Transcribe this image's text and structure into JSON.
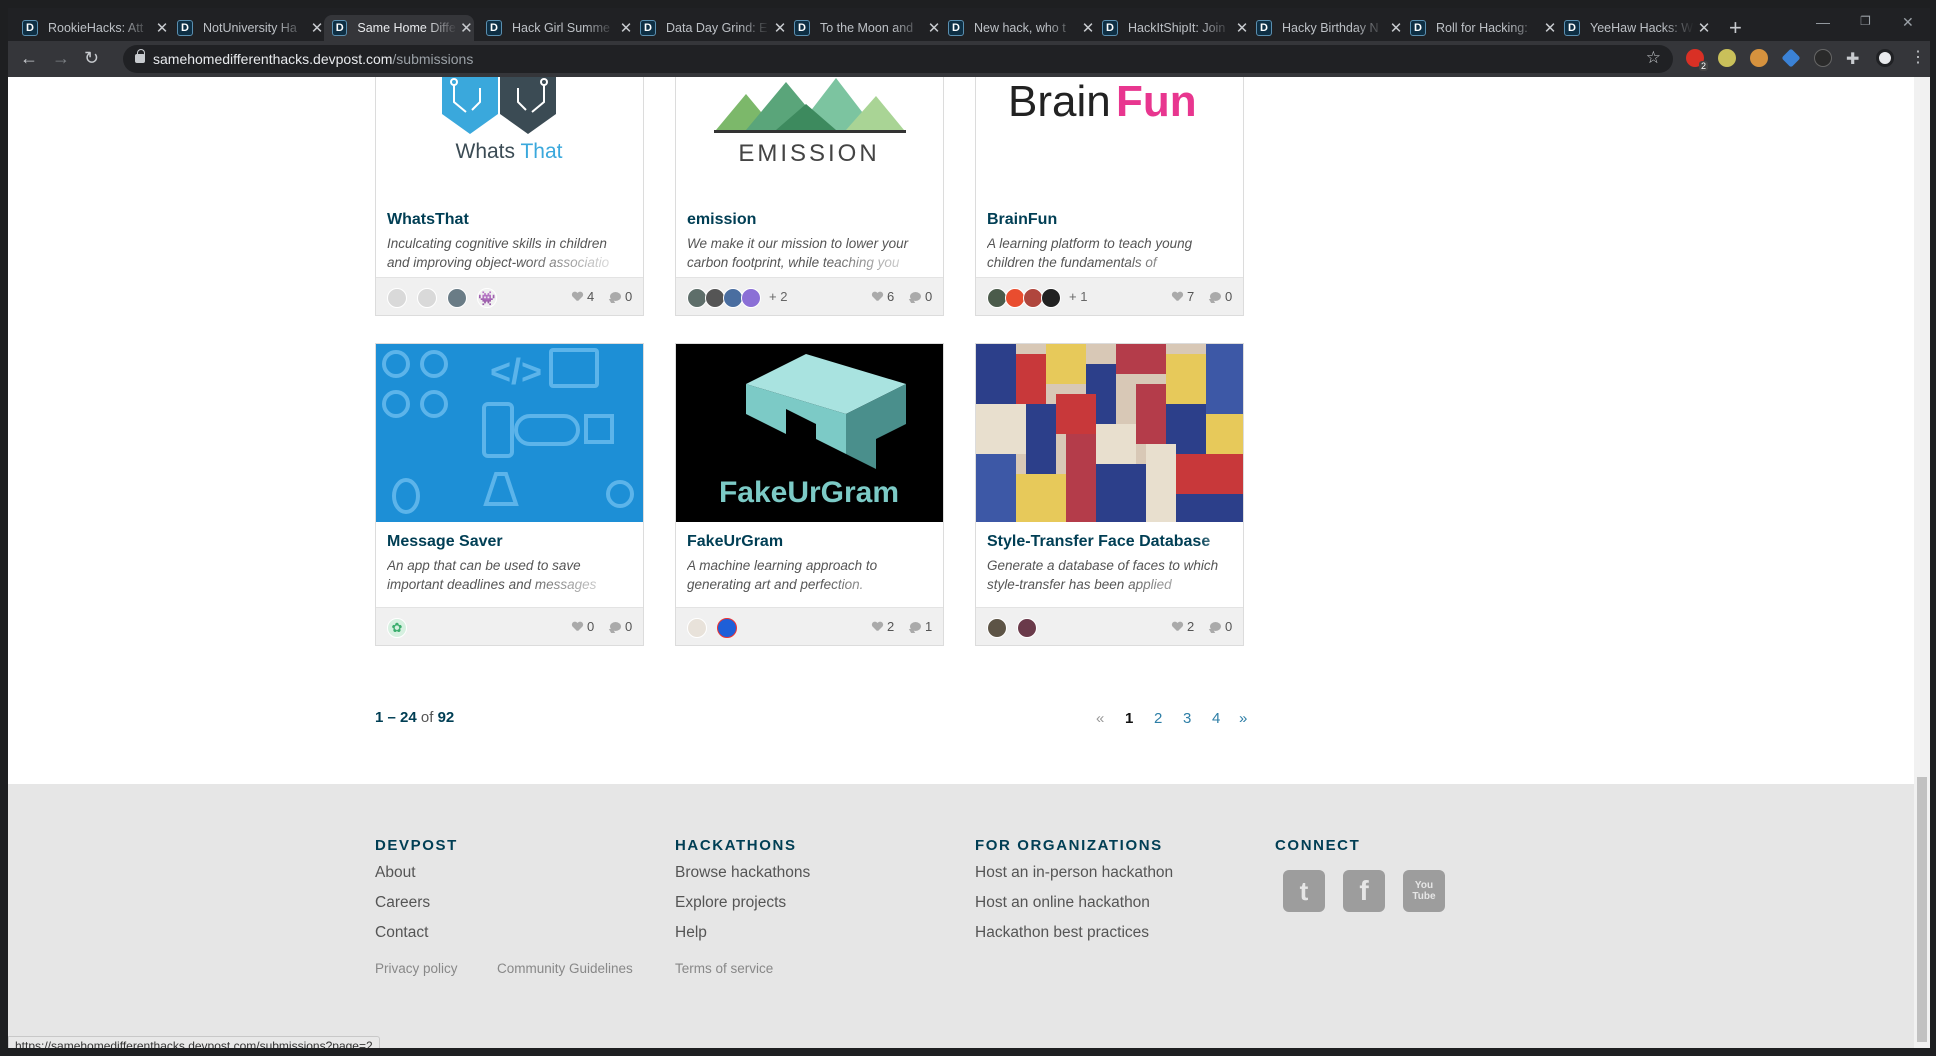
{
  "browser": {
    "tabs": [
      {
        "favicon": "D",
        "title": "RookieHacks: Att"
      },
      {
        "favicon": "D",
        "title": "NotUniversity Ha"
      },
      {
        "favicon": "D",
        "title": "Same Home Diffe"
      },
      {
        "favicon": "D",
        "title": "Hack Girl Summe"
      },
      {
        "favicon": "D",
        "title": "Data Day Grind: E"
      },
      {
        "favicon": "D",
        "title": "To the Moon and"
      },
      {
        "favicon": "D",
        "title": "New hack, who t"
      },
      {
        "favicon": "D",
        "title": "HackItShipIt: Join"
      },
      {
        "favicon": "D",
        "title": "Hacky Birthday N"
      },
      {
        "favicon": "D",
        "title": "Roll for Hacking:"
      },
      {
        "favicon": "D",
        "title": "YeeHaw Hacks: W"
      }
    ],
    "active_tab_index": 2,
    "url_host": "samehomedifferenthacks.devpost.com",
    "url_path": "/submissions",
    "extension_badge": "2"
  },
  "projects": [
    {
      "title": "WhatsThat",
      "desc1": "Inculcating cognitive skills in children",
      "desc2": "and improving object-word associatio",
      "likes": "4",
      "comments": "0",
      "extra": "",
      "image_text": "WhatsThat"
    },
    {
      "title": "emission",
      "desc1": "We make it our mission to lower your",
      "desc2": "carbon footprint, while teaching you",
      "likes": "6",
      "comments": "0",
      "extra": "+ 2",
      "image_text": "EMISSION"
    },
    {
      "title": "BrainFun",
      "desc1": "A learning platform to teach young",
      "desc2": "children the fundamentals of",
      "likes": "7",
      "comments": "0",
      "extra": "+ 1",
      "image_text_a": "Brain",
      "image_text_b": "Fun"
    },
    {
      "title": "Message Saver",
      "desc1": "An app that can be used to save",
      "desc2": "important deadlines and messages",
      "likes": "0",
      "comments": "0",
      "extra": "",
      "image_text": "</>"
    },
    {
      "title": "FakeUrGram",
      "desc1": "A machine learning approach to",
      "desc2": "generating art and perfection.",
      "likes": "2",
      "comments": "1",
      "extra": "",
      "image_text": "FakeUrGram"
    },
    {
      "title": "Style-Transfer Face Database",
      "desc1": "Generate a database of faces to which",
      "desc2": "style-transfer has been applied",
      "likes": "2",
      "comments": "0",
      "extra": "",
      "image_text": ""
    }
  ],
  "pagination": {
    "range": "1 – 24",
    "of_label": "of",
    "total": "92",
    "prev": "«",
    "pages": [
      "1",
      "2",
      "3",
      "4"
    ],
    "current": "1",
    "next": "»"
  },
  "footer": {
    "columns": [
      {
        "heading": "DEVPOST",
        "links": [
          "About",
          "Careers",
          "Contact"
        ]
      },
      {
        "heading": "HACKATHONS",
        "links": [
          "Browse hackathons",
          "Explore projects",
          "Help"
        ]
      },
      {
        "heading": "FOR ORGANIZATIONS",
        "links": [
          "Host an in-person hackathon",
          "Host an online hackathon",
          "Hackathon best practices"
        ]
      },
      {
        "heading": "CONNECT",
        "links": []
      }
    ],
    "social": [
      "twitter-icon",
      "facebook-icon",
      "youtube-icon"
    ],
    "social_glyphs": [
      "t",
      "f",
      "You Tube"
    ],
    "legal": [
      "Privacy policy",
      "Community Guidelines",
      "Terms of service"
    ]
  },
  "status_url": "https://samehomedifferenthacks.devpost.com/submissions?page=2",
  "colors": {
    "brand": "#003e54",
    "link": "#2d7ea6",
    "chrome_dark": "#202124"
  }
}
